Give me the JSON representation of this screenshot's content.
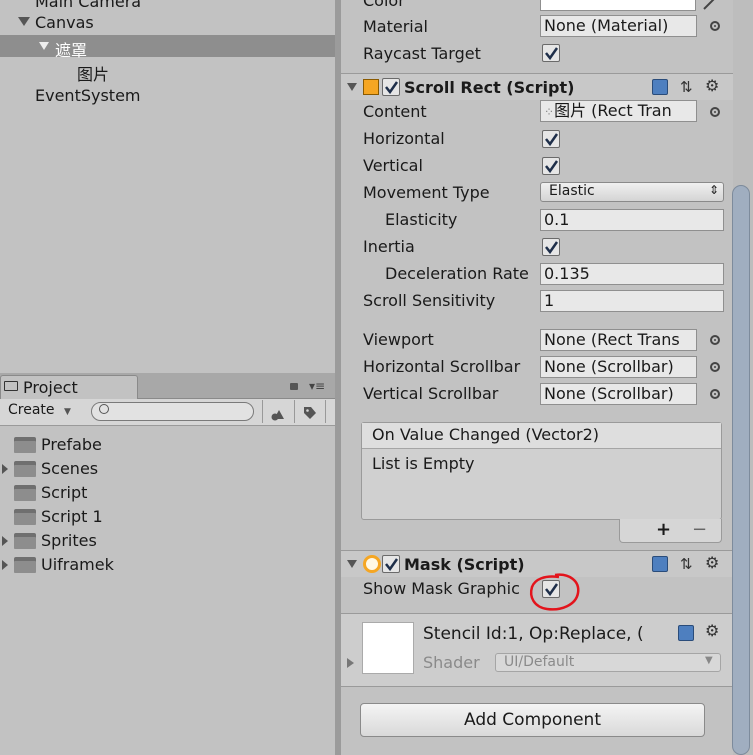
{
  "hierarchy": {
    "items": [
      "Main Camera",
      "Canvas",
      "遮罩",
      "图片",
      "EventSystem"
    ]
  },
  "project": {
    "tab_label": "Project",
    "create_label": "Create",
    "search_placeholder": "",
    "folders": [
      "Prefabe",
      "Scenes",
      "Script",
      "Script 1",
      "Sprites",
      "Uiframek"
    ]
  },
  "image_component": {
    "color_label": "Color",
    "material_label": "Material",
    "material_value": "None (Material)",
    "raycast_label": "Raycast Target"
  },
  "scroll_rect": {
    "title": "Scroll Rect (Script)",
    "content_label": "Content",
    "content_value": "图片 (Rect Tran",
    "horizontal_label": "Horizontal",
    "vertical_label": "Vertical",
    "movement_label": "Movement Type",
    "movement_value": "Elastic",
    "elasticity_label": "Elasticity",
    "elasticity_value": "0.1",
    "inertia_label": "Inertia",
    "decel_label": "Deceleration Rate",
    "decel_value": "0.135",
    "sensitivity_label": "Scroll Sensitivity",
    "sensitivity_value": "1",
    "viewport_label": "Viewport",
    "viewport_value": "None (Rect Trans",
    "hscroll_label": "Horizontal Scrollbar",
    "hscroll_value": "None (Scrollbar)",
    "vscroll_label": "Vertical Scrollbar",
    "vscroll_value": "None (Scrollbar)",
    "event_title": "On Value Changed (Vector2)",
    "event_body": "List is Empty",
    "plus": "+",
    "minus": "−"
  },
  "mask": {
    "title": "Mask (Script)",
    "show_graphic_label": "Show Mask Graphic"
  },
  "material_preview": {
    "stencil_text": "Stencil Id:1, Op:Replace, (",
    "shader_label": "Shader",
    "shader_value": "UI/Default"
  },
  "add_component_label": "Add Component",
  "colors": {
    "annotation_red": "#e3141c",
    "panel_bg": "#c2c2c2",
    "selection": "#8e8e8e"
  }
}
